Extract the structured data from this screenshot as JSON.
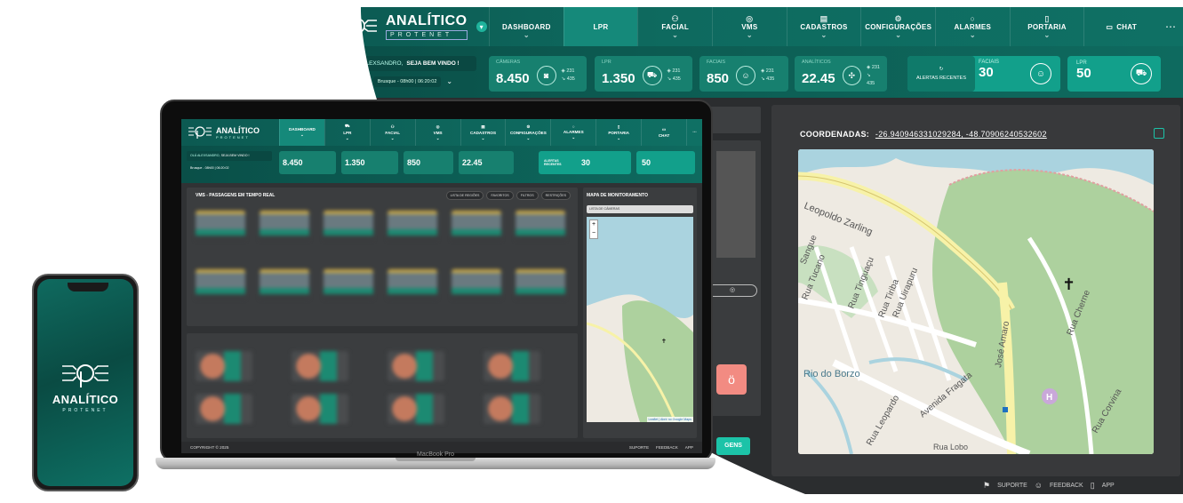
{
  "brand": {
    "title": "ANALÍTICO",
    "subtitle": "PROTENET"
  },
  "nav": {
    "items": [
      {
        "label": "DASHBOARD",
        "icon": "dashboard-icon"
      },
      {
        "label": "LPR",
        "icon": "car-icon"
      },
      {
        "label": "FACIAL",
        "icon": "face-icon"
      },
      {
        "label": "VMS",
        "icon": "camera-icon"
      },
      {
        "label": "CADASTROS",
        "icon": "list-icon"
      },
      {
        "label": "CONFIGURAÇÕES",
        "icon": "gear-icon"
      },
      {
        "label": "ALARMES",
        "icon": "bell-icon"
      },
      {
        "label": "PORTARIA",
        "icon": "door-icon"
      },
      {
        "label": "CHAT",
        "icon": "chat-icon"
      }
    ],
    "more": "⋯"
  },
  "greeting": {
    "prefix": "OLÁ ALEXSANDRO,",
    "message": "SEJA BEM VINDO !"
  },
  "weather": {
    "location": "Brusque - 08h00 | 06:20:02"
  },
  "stats": {
    "cameras": {
      "label": "CÂMERAS",
      "value": "8.450",
      "up": "231",
      "down": "435"
    },
    "lpr": {
      "label": "LPR",
      "value": "1.350",
      "up": "231",
      "down": "435"
    },
    "facial": {
      "label": "FACIAIS",
      "value": "850",
      "up": "231",
      "down": "435"
    },
    "analytic": {
      "label": "ANALÍTICOS",
      "value": "22.45",
      "up": "231",
      "down": "435"
    }
  },
  "alerts": {
    "label": "ALERTAS RECENTES",
    "faces_label": "FACIAIS",
    "faces_value": "30",
    "lpr_label": "LPR",
    "lpr_value": "50"
  },
  "map": {
    "coords_label": "COORDENADAS:",
    "coords_value": "-26.940946331029284, -48.70906240532602",
    "streets": [
      "Leopoldo Zarling",
      "Rua Tucano",
      "Rua Tinguaçu",
      "Rua Tiriba",
      "Rua Uirapuru",
      "Rua Cherne",
      "Rua Corvina",
      "Rio do Borzo",
      "Avenida Fragata",
      "Rua Leopardo",
      "José Amaro",
      "Sangue",
      "Rua Lobo"
    ]
  },
  "footer": {
    "support": "SUPORTE",
    "feedback": "FEEDBACK",
    "app": "APP",
    "copyright": "COPYRIGHT © 2025"
  },
  "laptop": {
    "panel_vms_title": "VMS - PASSAGENS EM TEMPO REAL",
    "filters": [
      "LISTA DE REGIÕES",
      "FAVORITOS",
      "FILTROS",
      "RESTRIÇÕES"
    ],
    "map_title": "MAPA DE MONITORAMENTO",
    "map_select": "LISTA DE CÂMERAS",
    "attribution": "Leaflet | Abrir no Google Maps",
    "device": "MacBook Pro",
    "partial_button": "GENS"
  },
  "colors": {
    "brand_dark": "#0c5a52",
    "brand_accent": "#15897a",
    "teal_card": "#12a08b"
  }
}
